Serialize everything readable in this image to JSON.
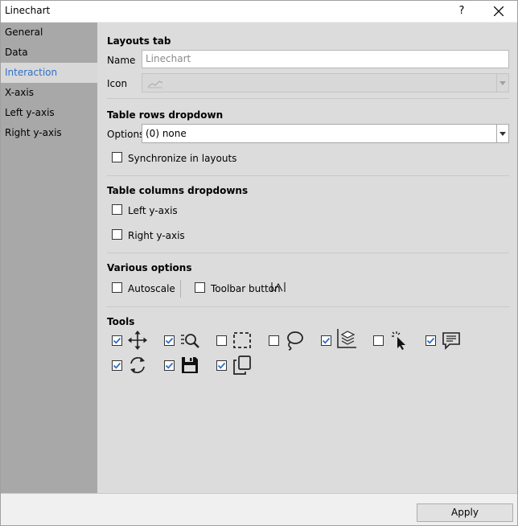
{
  "window": {
    "title": "Linechart",
    "help": "?"
  },
  "sidebar": {
    "items": [
      {
        "label": "General"
      },
      {
        "label": "Data"
      },
      {
        "label": "Interaction",
        "active": true
      },
      {
        "label": "X-axis"
      },
      {
        "label": "Left y-axis"
      },
      {
        "label": "Right y-axis"
      }
    ]
  },
  "layouts_tab": {
    "title": "Layouts tab",
    "name_label": "Name",
    "name_value": "Linechart",
    "icon_label": "Icon",
    "icon": "linechart-icon"
  },
  "table_rows": {
    "title": "Table rows dropdown",
    "options_label": "Options",
    "options_value": "(0) none",
    "sync_label": "Synchronize in layouts",
    "sync_checked": false
  },
  "table_columns": {
    "title": "Table columns dropdowns",
    "left_label": "Left y-axis",
    "left_checked": false,
    "right_label": "Right y-axis",
    "right_checked": false
  },
  "various": {
    "title": "Various options",
    "autoscale_label": "Autoscale",
    "autoscale_checked": false,
    "toolbar_label": "Toolbar button",
    "toolbar_checked": false,
    "toolbar_icon": "autoscale-icon"
  },
  "tools": {
    "title": "Tools",
    "items": [
      {
        "icon": "move-icon",
        "checked": true
      },
      {
        "icon": "zoom-icon",
        "checked": true
      },
      {
        "icon": "select-rect-icon",
        "checked": false
      },
      {
        "icon": "lasso-icon",
        "checked": false
      },
      {
        "icon": "layers-icon",
        "checked": true
      },
      {
        "icon": "pointer-icon",
        "checked": false
      },
      {
        "icon": "annotation-icon",
        "checked": true
      },
      {
        "icon": "refresh-icon",
        "checked": true
      },
      {
        "icon": "save-icon",
        "checked": true
      },
      {
        "icon": "copy-icon",
        "checked": true
      }
    ]
  },
  "footer": {
    "apply_label": "Apply"
  },
  "colors": {
    "accent": "#2f6fc8",
    "sidebar": "#a8a8a8",
    "content": "#dcdcdc",
    "check": "#2f6fc8"
  }
}
